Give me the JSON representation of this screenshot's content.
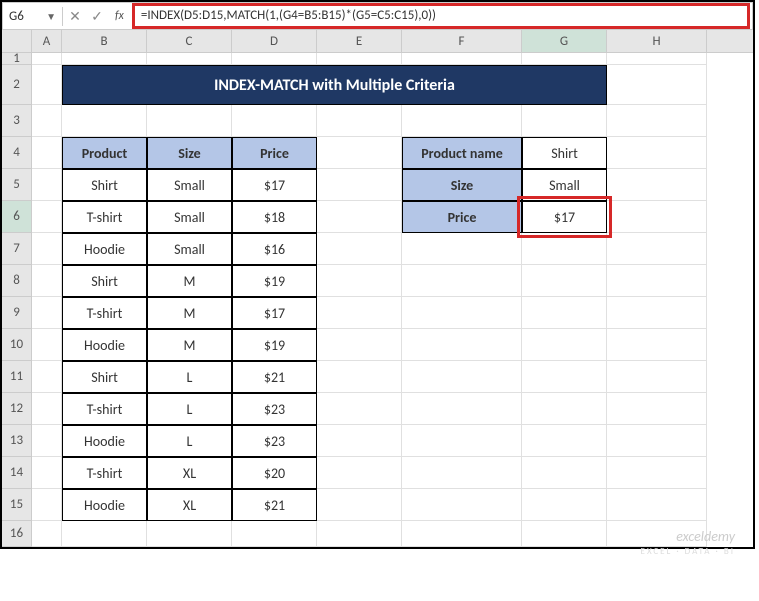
{
  "nameBox": "G6",
  "formula": "=INDEX(D5:D15,MATCH(1,(G4=B5:B15)*(G5=C5:C15),0))",
  "title": "INDEX-MATCH with Multiple Criteria",
  "columns": [
    "A",
    "B",
    "C",
    "D",
    "E",
    "F",
    "G",
    "H"
  ],
  "rows": [
    "1",
    "2",
    "3",
    "4",
    "5",
    "6",
    "7",
    "8",
    "9",
    "10",
    "11",
    "12",
    "13",
    "14",
    "15",
    "16"
  ],
  "headers": {
    "product": "Product",
    "size": "Size",
    "price": "Price"
  },
  "data": [
    {
      "product": "Shirt",
      "size": "Small",
      "price": "$17"
    },
    {
      "product": "T-shirt",
      "size": "Small",
      "price": "$18"
    },
    {
      "product": "Hoodie",
      "size": "Small",
      "price": "$16"
    },
    {
      "product": "Shirt",
      "size": "M",
      "price": "$19"
    },
    {
      "product": "T-shirt",
      "size": "M",
      "price": "$17"
    },
    {
      "product": "Hoodie",
      "size": "M",
      "price": "$19"
    },
    {
      "product": "Shirt",
      "size": "L",
      "price": "$21"
    },
    {
      "product": "T-shirt",
      "size": "L",
      "price": "$23"
    },
    {
      "product": "Hoodie",
      "size": "L",
      "price": "$23"
    },
    {
      "product": "T-shirt",
      "size": "XL",
      "price": "$20"
    },
    {
      "product": "Hoodie",
      "size": "XL",
      "price": "$21"
    }
  ],
  "lookup": {
    "productNameLabel": "Product name",
    "productNameVal": "Shirt",
    "sizeLabel": "Size",
    "sizeVal": "Small",
    "priceLabel": "Price",
    "priceVal": "$17"
  },
  "watermark": "exceldemy",
  "watermarkSub": "EXCEL · DATA · BI"
}
